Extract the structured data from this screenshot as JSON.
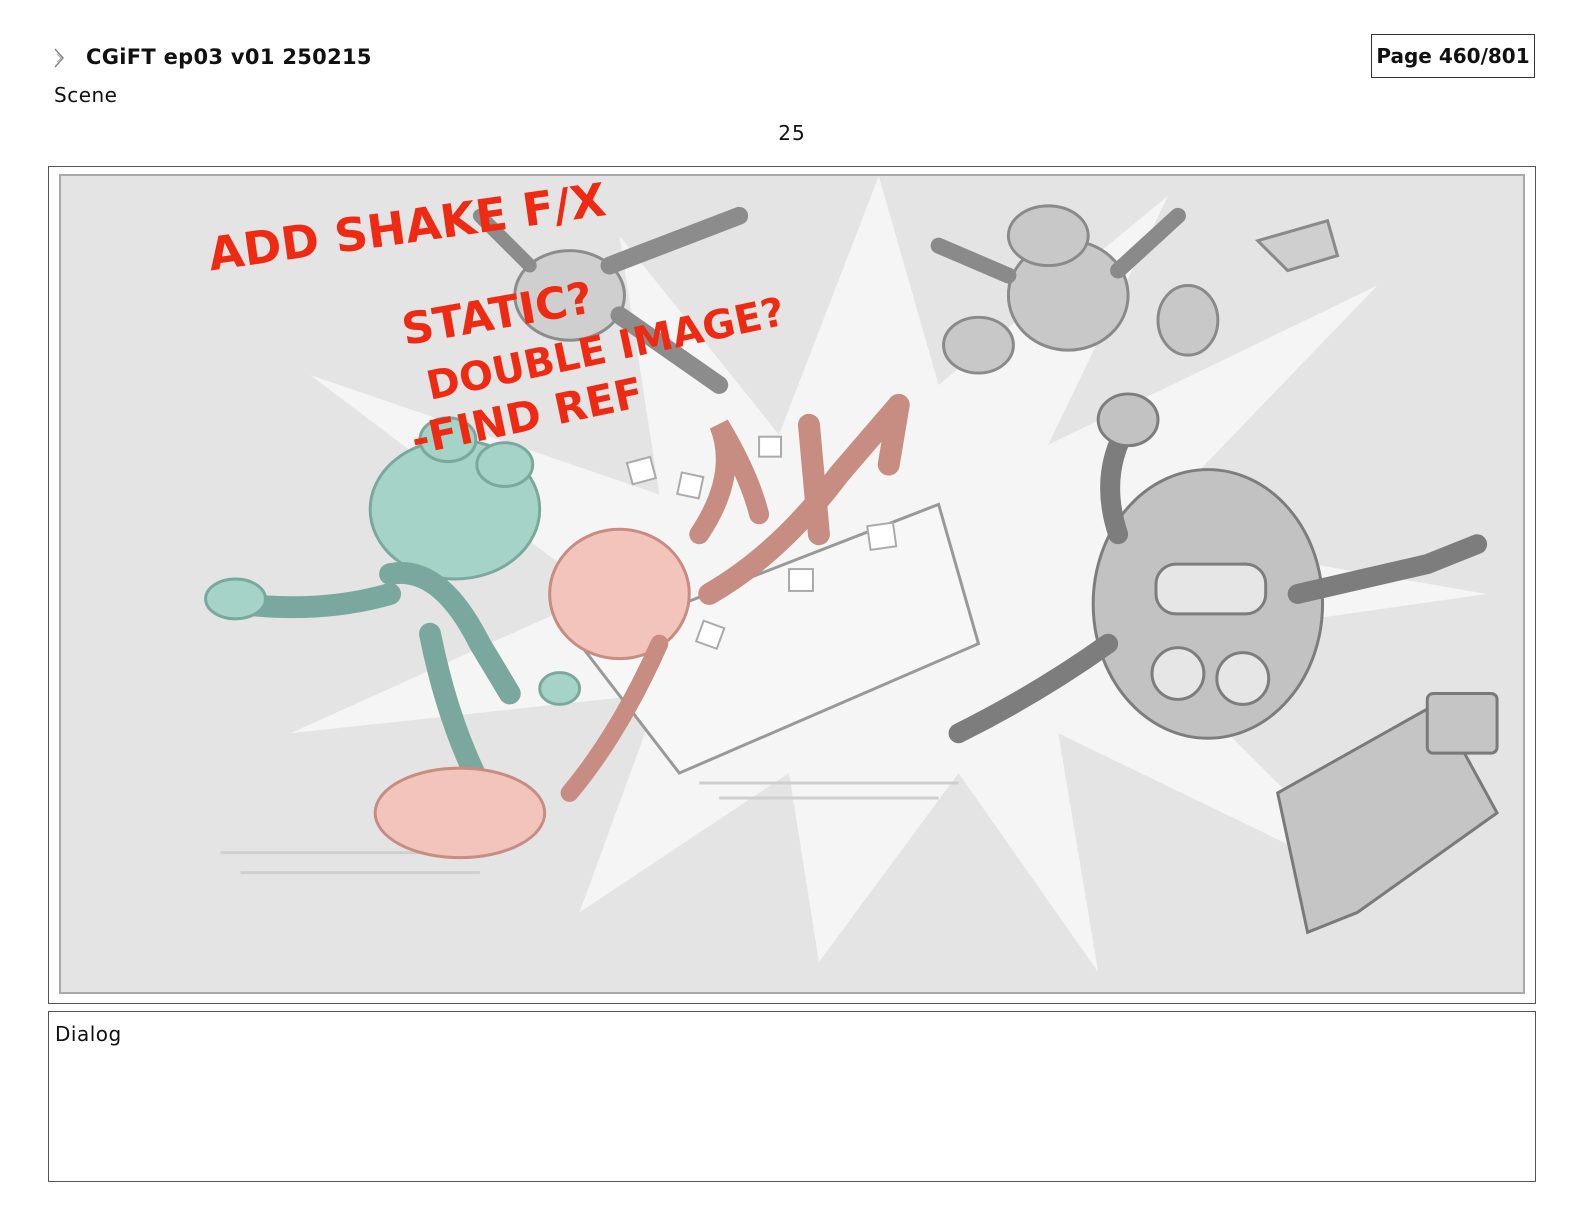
{
  "header": {
    "title": "CGiFT ep03 v01 250215",
    "page": "Page 460/801"
  },
  "scene": {
    "label": "Scene",
    "number": "25"
  },
  "panel": {
    "annotations": [
      "ADD SHAKE F/X",
      "STATIC?",
      "DOUBLE IMAGE?",
      "-FIND REF"
    ],
    "annotation_color": "#ee2a12"
  },
  "dialog": {
    "label": "Dialog"
  },
  "icons": {
    "header": "triangle-marker-icon"
  }
}
